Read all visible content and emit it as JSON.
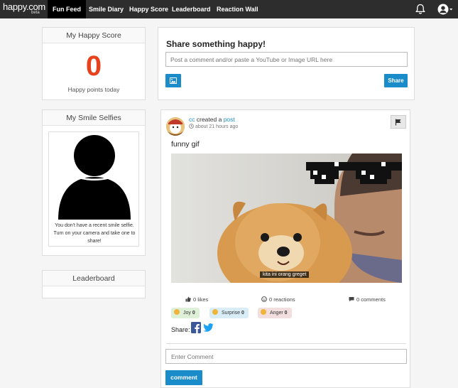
{
  "navbar": {
    "logo_text": "happy.com",
    "logo_beta": "beta",
    "items": [
      {
        "label": "Fun Feed",
        "active": true
      },
      {
        "label": "Smile Diary",
        "active": false
      },
      {
        "label": "Happy Score",
        "active": false
      },
      {
        "label": "Leaderboard",
        "active": false
      },
      {
        "label": "Reaction Wall",
        "active": false
      }
    ],
    "icons": [
      "bell-icon",
      "user-icon",
      "caret-down-icon"
    ]
  },
  "happy_score": {
    "title": "My Happy Score",
    "value": "0",
    "label": "Happy points today",
    "color": "#e8421c"
  },
  "smile_selfies": {
    "title": "My Smile Selfies",
    "empty_message": "You don't have a recent smile selfie. Turn on your camera and take one to share!"
  },
  "leaderboard": {
    "title": "Leaderboard"
  },
  "share_box": {
    "title": "Share something happy!",
    "placeholder": "Post a comment and/or paste a YouTube or Image URL here",
    "image_icon": "image-icon",
    "share_button": "Share"
  },
  "post": {
    "author": "cc",
    "action_text": "created a",
    "object_link": "post",
    "time": "about 21 hours ago",
    "text": "funny gif",
    "image_caption": "kita ini orang greget",
    "likes": "0 likes",
    "reactions_count": "0 reactions",
    "comments_count": "0 comments",
    "reactions": [
      {
        "label": "Joy",
        "count": "0",
        "bg": "#dff0d8"
      },
      {
        "label": "Surprise",
        "count": "0",
        "bg": "#d9edf7"
      },
      {
        "label": "Anger",
        "count": "0",
        "bg": "#f2dede"
      }
    ],
    "share_label": "Share:",
    "comment_placeholder": "Enter Comment",
    "comment_button": "comment"
  },
  "colors": {
    "accent": "#1a8cc9",
    "navbar": "#2d2d2d",
    "facebook": "#3b5998",
    "twitter": "#1da1f2"
  }
}
